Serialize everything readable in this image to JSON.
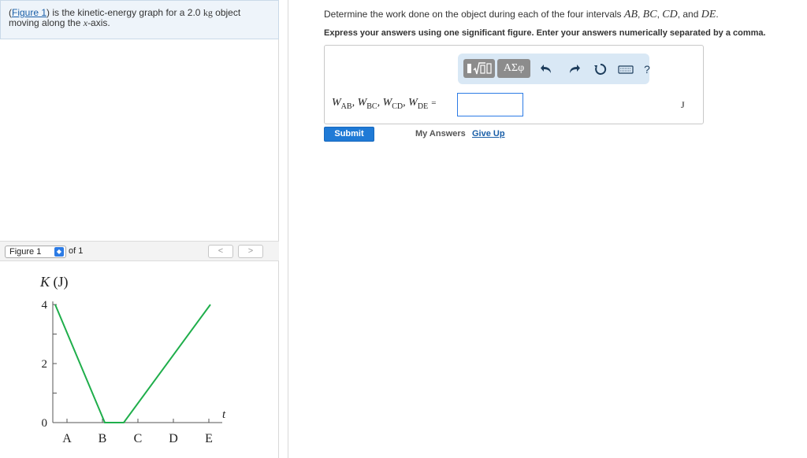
{
  "intro": {
    "link_text": "Figure 1",
    "open_paren": "(",
    "text_1": ") is the kinetic-energy graph for a 2.0 ",
    "unit_kg": "kg",
    "text_2": " object moving along the ",
    "axis_var": "x",
    "text_3": "-axis."
  },
  "figure_nav": {
    "selected": "Figure 1",
    "of_text": "of 1",
    "prev_symbol": "<",
    "next_symbol": ">"
  },
  "question": {
    "text": "Determine the work done on the object during each of the four intervals ",
    "ab": "AB",
    "bc": "BC",
    "cd": "CD",
    "and_text": ", and ",
    "de": "DE",
    "period": ".",
    "comma": ", ",
    "instruction": "Express your answers using one significant figure. Enter your answers numerically separated by a comma."
  },
  "answer": {
    "var_symbol": "W",
    "subs": [
      "AB",
      "BC",
      "CD",
      "DE"
    ],
    "eq": "=",
    "value": "",
    "unit": "J"
  },
  "toolbar": {
    "symbols_label": "ΑΣφ",
    "undo_icon": "undo-arrow-icon",
    "redo_icon": "redo-arrow-icon",
    "reset_icon": "reset-icon",
    "keyboard_icon": "keyboard-icon",
    "help_label": "?"
  },
  "actions": {
    "submit": "Submit",
    "my_answers": "My Answers",
    "give_up": "Give Up"
  },
  "colors": {
    "accent": "#1f7ad6",
    "line": "#1fae4b"
  },
  "chart_data": {
    "type": "line",
    "ylabel_var": "K",
    "ylabel_unit": "(J)",
    "xlabel": "t",
    "ylim": [
      0,
      4
    ],
    "y_tick_labels": [
      "0",
      "2",
      "4"
    ],
    "y_minor_ticks": [
      1,
      3
    ],
    "x_tick_labels": [
      "A",
      "B",
      "C",
      "D",
      "E"
    ],
    "series": [
      {
        "x": [
          0,
          1,
          2,
          3,
          4
        ],
        "values": [
          4,
          0,
          0,
          2,
          4
        ]
      }
    ]
  }
}
